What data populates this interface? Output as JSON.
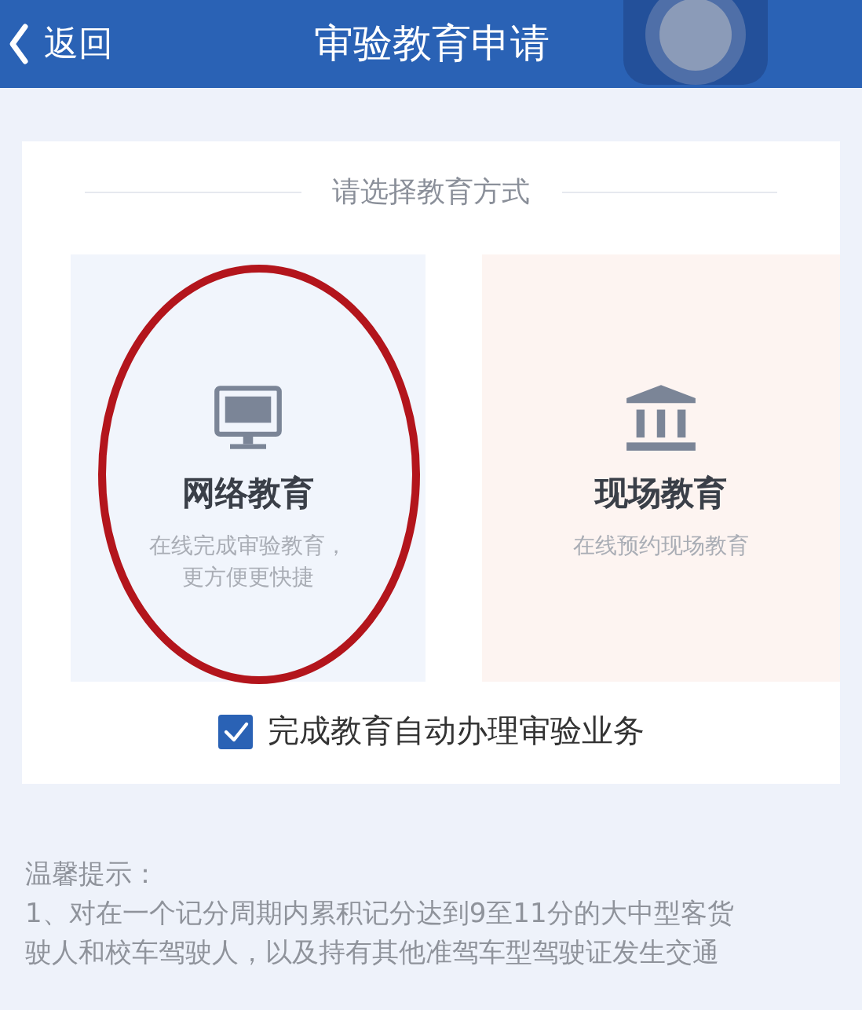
{
  "header": {
    "back_label": "返回",
    "title": "审验教育申请"
  },
  "prompt": "请选择教育方式",
  "options": [
    {
      "kind": "online",
      "title": "网络教育",
      "description": [
        "在线完成审验教育，",
        "更方便更快捷"
      ],
      "circled": true
    },
    {
      "kind": "onsite",
      "title": "现场教育",
      "description": [
        "在线预约现场教育"
      ],
      "circled": false
    }
  ],
  "auto_process": {
    "label": "完成教育自动办理审验业务",
    "checked": true
  },
  "notice": {
    "title": "温馨提示：",
    "lines": [
      "1、对在一个记分周期内累积记分达到9至11分的大中型客货",
      "驶人和校车驾驶人，以及持有其他准驾车型驾驶证发生交通"
    ]
  }
}
